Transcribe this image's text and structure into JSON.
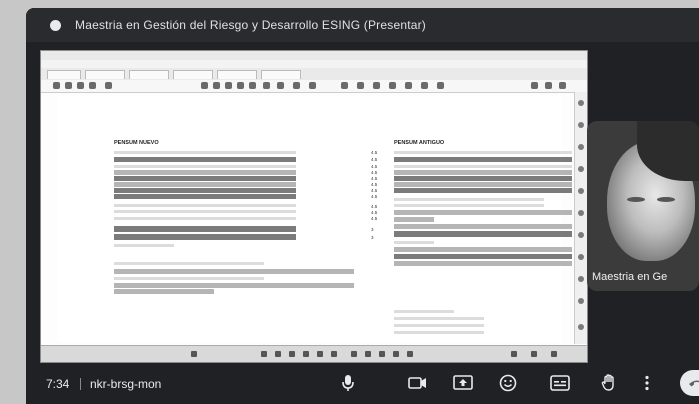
{
  "meeting": {
    "presentation_title": "Maestria en Gestión del Riesgo y Desarrollo ESING (Presentar)",
    "time": "7:34",
    "meeting_code": "nkr-brsg-mon"
  },
  "participant": {
    "name": "Maestria en Ge"
  },
  "document": {
    "left_title": "PENSUM NUEVO",
    "right_title": "PENSUM ANTIGUO",
    "left_numbers": [
      "4.5",
      "4.5",
      "4.5",
      "4.5",
      "4.5",
      "4.5",
      "4.5",
      "4.5",
      "4.5",
      "4.5",
      "4.5",
      "3",
      "3"
    ]
  },
  "controls": {
    "mic_icon": "mic-icon",
    "camera_icon": "camera-icon",
    "present_icon": "present-screen-icon",
    "emoji_icon": "emoji-icon",
    "captions_icon": "captions-icon",
    "hand_icon": "raise-hand-icon",
    "more_icon": "more-options-icon",
    "end_call_icon": "end-call-icon"
  }
}
